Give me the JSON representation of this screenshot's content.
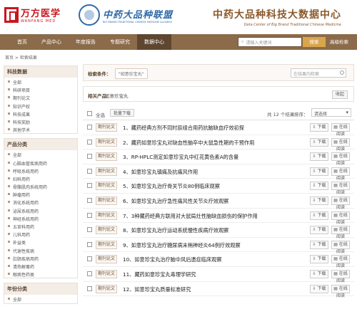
{
  "header": {
    "logo1_cn": "万方医学",
    "logo1_en": "WANFANG MED",
    "logo2_cn": "中药大品种联盟",
    "logo2_en": "BIG BRAND TRADITIONAL CHINESE MEDICINE ALLIANCE",
    "site_title": "中药大品种科技大数据中心",
    "site_subtitle": "Data Center of Big Brand Traditional Chinese Medicine"
  },
  "nav": {
    "items": [
      "首页",
      "产品中心",
      "年度报告",
      "专题研究",
      "数据中心"
    ],
    "active_index": 4,
    "search_placeholder": "请输入关键词",
    "search_button": "搜索",
    "advanced": "高级检索"
  },
  "breadcrumb": "首页 > 检索结果",
  "sidebar": {
    "sections": [
      {
        "title": "科技数据",
        "items": [
          "全部",
          "科研项目",
          "期刊论文",
          "知识产权",
          "科技成果",
          "科技奖励",
          "其他学术"
        ]
      },
      {
        "title": "产品分类",
        "items": [
          "全部",
          "心脑血管疾病用药",
          "呼吸系统用药",
          "妇科用药",
          "骨骼肌肉系统用药",
          "肿瘤用药",
          "消化系统用药",
          "泌尿系统用药",
          "神经系统用药",
          "五官科用药",
          "儿科用药",
          "补益类",
          "代谢性疾病",
          "肛肠疾病用药",
          "清热解毒药",
          "眼病性药类"
        ]
      },
      {
        "title": "年份分类",
        "items": [
          "全部"
        ]
      }
    ]
  },
  "search_condition": {
    "label": "检索条件：",
    "tag": "\"如意珍宝丸\"",
    "result_search_placeholder": "在结果内检索"
  },
  "related": {
    "label": "相关产品：",
    "value": "如意珍宝丸",
    "collapse": "收起"
  },
  "toolbar": {
    "select_all": "全选",
    "batch_download": "批量下载",
    "count": "共 12 个结果",
    "sort_label": "排序：",
    "sort_value": "请选择"
  },
  "results": [
    {
      "type": "期刊论文",
      "title": "1、藏药经典方剂不同时辰组合用药抗脑缺血疗效初探",
      "download": "下载",
      "read": "在线阅读"
    },
    {
      "type": "期刊论文",
      "title": "2、藏药如意珍宝丸对缺血性脑卒中大鼠急性期的干预作用",
      "download": "下载",
      "read": "在线阅读"
    },
    {
      "type": "期刊论文",
      "title": "3、RP-HPLC测定如意珍宝丸中红花黄色素A的含量",
      "download": "下载",
      "read": "在线阅读"
    },
    {
      "type": "期刊论文",
      "title": "4、如意珍宝丸镇痛及抗痛风作用",
      "download": "下载",
      "read": "在线阅读"
    },
    {
      "type": "期刊论文",
      "title": "5、如意珍宝丸治疗骨关节炎80例临床观察",
      "download": "下载",
      "read": "在线阅读"
    },
    {
      "type": "期刊论文",
      "title": "6、如意珍宝丸治疗急性痛风性关节炎疗效观察",
      "download": "下载",
      "read": "在线阅读"
    },
    {
      "type": "期刊论文",
      "title": "7、3种藏药经典方联用对大鼠局灶性脑缺血损伤的保护作用",
      "download": "下载",
      "read": "在线阅读"
    },
    {
      "type": "期刊论文",
      "title": "8、如意珍宝丸治疗运动系统慢性疾病疗效观察",
      "download": "下载",
      "read": "在线阅读"
    },
    {
      "type": "期刊论文",
      "title": "9、如意珍宝丸治疗糖尿病末梢神经炎64例疗效观察",
      "download": "下载",
      "read": "在线阅读"
    },
    {
      "type": "期刊论文",
      "title": "10、如意珍宝丸治疗脑中风后遗症临床观察",
      "download": "下载",
      "read": "在线阅读"
    },
    {
      "type": "期刊论文",
      "title": "11、藏药如意珍宝丸毒理学研究",
      "download": "下载",
      "read": "在线阅读"
    },
    {
      "type": "期刊论文",
      "title": "12、如意珍宝丸质量标准研究",
      "download": "下载",
      "read": "在线阅读"
    }
  ]
}
